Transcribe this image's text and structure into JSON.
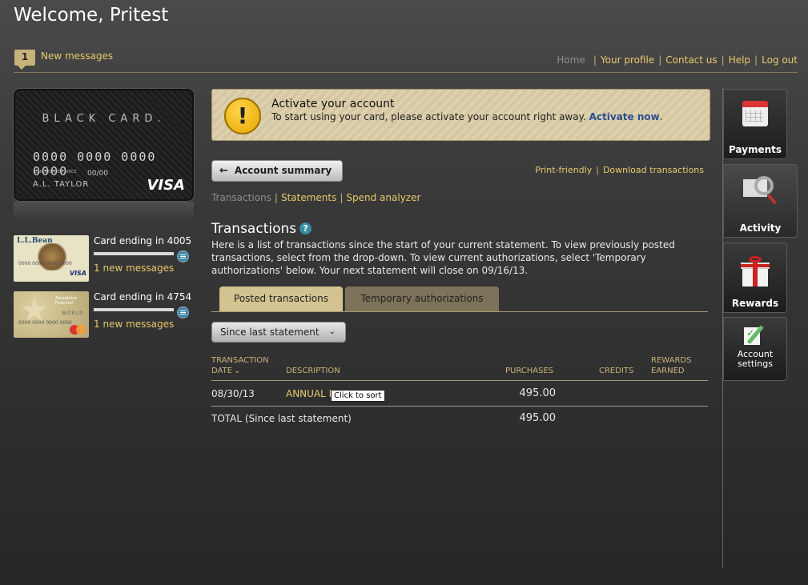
{
  "header": {
    "welcome": "Welcome, Pritest",
    "message_count": "1",
    "messages_label": "New messages",
    "nav": [
      "Home",
      "Your profile",
      "Contact us",
      "Help",
      "Log out"
    ]
  },
  "main_card": {
    "brand": "BLACK CARD.",
    "number": "0000 0000 0000 0000",
    "member_since_label": "CARDMEMBER SINCE",
    "good_thru_label": "GOOD THRU",
    "expiry": "00/00",
    "holder": "A.L. TAYLOR",
    "network": "VISA"
  },
  "other_cards": [
    {
      "label": "Card ending in 4005",
      "messages": "1 new messages",
      "brand": "L.L.Bean",
      "numbers": "0000 0000 0000 0000",
      "holder": "J. W. JONES",
      "network": "VISA"
    },
    {
      "label": "Card ending in 4754",
      "messages": "1 new messages",
      "brand": "Ameriprise Financial",
      "tier": "WORLD",
      "numbers": "0000 0000 0000 0000",
      "network": "MasterCard"
    }
  ],
  "activation": {
    "title": "Activate your account",
    "text": "To start using your card, please activate your account right away.",
    "link": "Activate now",
    "period": "."
  },
  "account_summary": {
    "button": "Account summary",
    "print_friendly": "Print-friendly",
    "download": "Download transactions"
  },
  "sub_nav": [
    "Transactions",
    "Statements",
    "Spend analyzer"
  ],
  "transactions": {
    "title": "Transactions",
    "help": "?",
    "description": "Here is a list of transactions since the start of your current statement. To view previously posted transactions, select from the drop-down. To view current authorizations, select 'Temporary authorizations' below. Your next statement will close on 09/16/13.",
    "tabs": [
      "Posted transactions",
      "Temporary authorizations"
    ],
    "period": "Since last statement",
    "columns": {
      "date": [
        "TRANSACTION",
        "DATE"
      ],
      "description": "DESCRIPTION",
      "purchases": "PURCHASES",
      "credits": "CREDITS",
      "rewards": [
        "REWARDS",
        "EARNED"
      ]
    },
    "rows": [
      {
        "date": "08/30/13",
        "description": "ANNUAL F",
        "purchases": "495.00"
      }
    ],
    "total_label": "TOTAL (Since last statement)",
    "total": "495.00",
    "tooltip": "Click to sort"
  },
  "sidebar": {
    "payments": "Payments",
    "activity": "Activity",
    "rewards": "Rewards",
    "settings_line1": "Account",
    "settings_line2": "settings"
  },
  "colors": {
    "accent_gold": "#e8c96a",
    "banner_bg": "#ddd0ae",
    "tab_active": "#d3c390",
    "tab_inactive": "#7d735a",
    "help_blue": "#3a8ca0"
  }
}
